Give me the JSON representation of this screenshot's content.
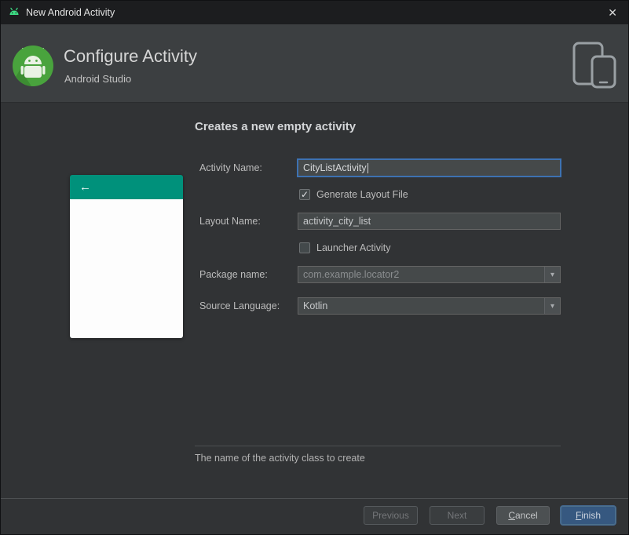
{
  "window": {
    "title": "New Android Activity"
  },
  "icons": {
    "close": "✕",
    "back_arrow": "←",
    "checkmark": "✓",
    "dropdown_arrow": "▾"
  },
  "header": {
    "title": "Configure Activity",
    "subtitle": "Android Studio"
  },
  "content": {
    "heading": "Creates a new empty activity",
    "fields": {
      "activity_name": {
        "label": "Activity Name:",
        "value": "CityListActivity"
      },
      "generate_layout_file": {
        "label": "Generate Layout File",
        "checked": true
      },
      "layout_name": {
        "label": "Layout Name:",
        "value": "activity_city_list"
      },
      "launcher_activity": {
        "label": "Launcher Activity",
        "checked": false
      },
      "package_name": {
        "label": "Package name:",
        "value": "com.example.locator2"
      },
      "source_language": {
        "label": "Source Language:",
        "value": "Kotlin"
      }
    },
    "hint": "The name of the activity class to create"
  },
  "buttons": {
    "previous": {
      "label": "Previous",
      "enabled": false
    },
    "next": {
      "label": "Next",
      "enabled": false
    },
    "cancel": {
      "mnemonic": "C",
      "rest": "ancel",
      "enabled": true
    },
    "finish": {
      "mnemonic": "F",
      "rest": "inish",
      "enabled": true
    }
  },
  "colors": {
    "preview_accent_teal": "#00917b",
    "focus_blue": "#3d72b2",
    "finish_button_blue": "#365880",
    "android_green": "#3ddc84"
  }
}
